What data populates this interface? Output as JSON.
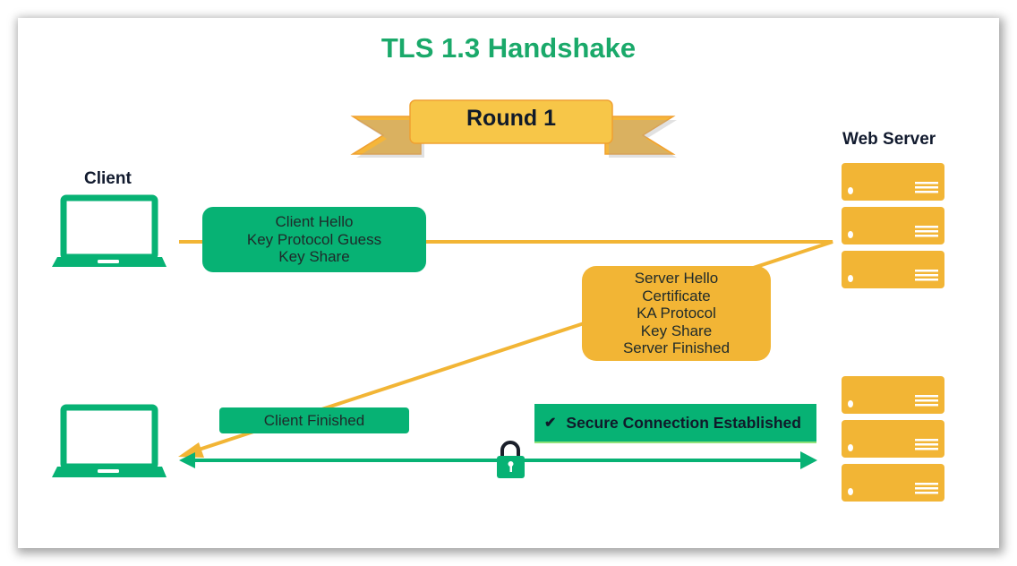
{
  "title": "TLS 1.3 Handshake",
  "banner": {
    "label": "Round 1"
  },
  "client": {
    "label": "Client"
  },
  "server": {
    "label": "Web Server"
  },
  "messages": {
    "client_hello": [
      "Client Hello",
      "Key Protocol Guess",
      "Key Share"
    ],
    "server_hello": [
      "Server Hello",
      "Certificate",
      "KA Protocol",
      "Key Share",
      "Server Finished"
    ],
    "client_finished": "Client Finished"
  },
  "status": {
    "check_icon": "✔",
    "text": "Secure Connection Established"
  },
  "colors": {
    "green": "#07b274",
    "orange": "#f2b535",
    "title": "#1aa96a"
  }
}
